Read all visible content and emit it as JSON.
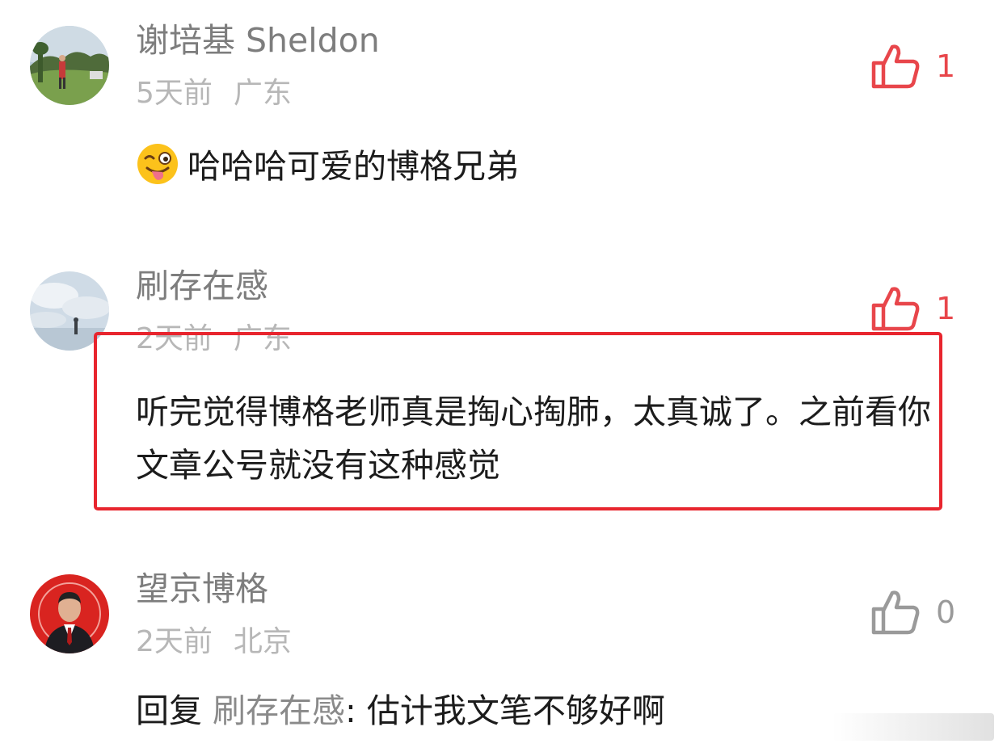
{
  "comments": [
    {
      "author": "谢培基 Sheldon",
      "time": "5天前",
      "location": "广东",
      "text": "哈哈哈可爱的博格兄弟",
      "emoji": "winking-tongue-emoji",
      "likes": "1",
      "like_color": "#e8464b",
      "avatar_icon": "golfer-photo-avatar"
    },
    {
      "author": "刷存在感",
      "time": "2天前",
      "location": "广东",
      "text": "听完觉得博格老师真是掏心掏肺，太真诚了。之前看你文章公号就没有这种感觉",
      "likes": "1",
      "like_color": "#e8464b",
      "avatar_icon": "sky-photo-avatar"
    },
    {
      "author": "望京博格",
      "time": "2天前",
      "location": "北京",
      "reply_prefix": "回复",
      "reply_to": "刷存在感",
      "text": ": 估计我文笔不够好啊",
      "likes": "0",
      "like_color": "#9a9a9a",
      "avatar_icon": "man-in-suit-avatar"
    }
  ],
  "highlight_color": "#e8252e"
}
